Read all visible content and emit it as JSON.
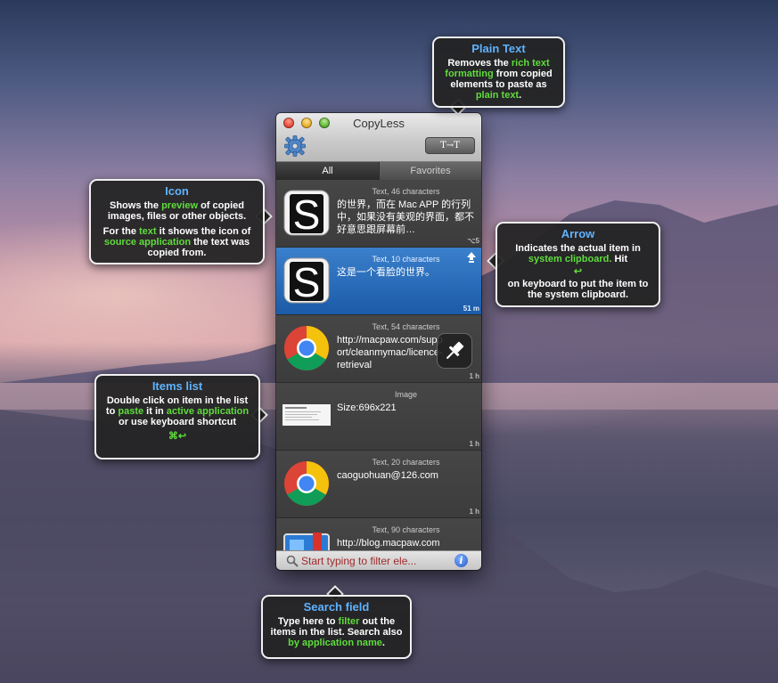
{
  "window": {
    "title": "CopyLess"
  },
  "toolbar": {
    "plain_text_button": "T→T"
  },
  "tabs": [
    {
      "label": "All",
      "active": true
    },
    {
      "label": "Favorites",
      "active": false
    }
  ],
  "items": [
    {
      "type": "Text, 46 characters",
      "text": "的世界，而在 Mac APP 的行列中，如果没有美观的界面，都不好意思跟屏幕前…",
      "time": "⌥5",
      "icon": "scrivener-icon"
    },
    {
      "type": "Text, 10 characters",
      "text": "这是一个看脸的世界。",
      "time": "51 m",
      "icon": "scrivener-icon",
      "selected": true
    },
    {
      "type": "Text, 54 characters",
      "text": "http://macpaw.com/support/cleanmymac/licence-retrieval",
      "time": "1 h",
      "icon": "chrome-icon"
    },
    {
      "type": "Image",
      "text": "Size:696x221",
      "time": "1 h",
      "icon": "image-preview"
    },
    {
      "type": "Text, 20 characters",
      "text": "caoguohuan@126.com",
      "time": "1 h",
      "icon": "chrome-icon"
    },
    {
      "type": "Text, 90 characters",
      "text": "http://blog.macpaw.com",
      "time": "",
      "icon": "finder-icon"
    }
  ],
  "search": {
    "placeholder": "Start typing to filter ele..."
  },
  "callouts": {
    "plain_text": {
      "title": "Plain Text",
      "p1": "Removes the ",
      "h1": "rich text formatting",
      "p2": " from copied elements to paste as ",
      "h2": "plain text",
      "p3": "."
    },
    "icon": {
      "title": "Icon",
      "a1": "Shows the ",
      "ah1": "preview",
      "a2": " of copied images, files or other objects.",
      "b1": "For the ",
      "bh1": "text",
      "b2": " it shows the icon of ",
      "bh2": "source application",
      "b3": " the text was copied from."
    },
    "arrow": {
      "title": "Arrow",
      "p1": "Indicates the actual item in ",
      "h1": "system clipboard.",
      "p2": " Hit",
      "key": "↩",
      "p3": "on keyboard to put the item to the system clipboard."
    },
    "items_list": {
      "title": "Items list",
      "p1": "Double click on item in the list to ",
      "h1": "paste",
      "p2": " it in ",
      "h2": "active application",
      "p3": " or use keyboard shortcut",
      "key": "⌘↩"
    },
    "search_field": {
      "title": "Search field",
      "p1": "Type here to ",
      "h1": "filter",
      "p2": " out the items in the list. Search also ",
      "h2": "by application name",
      "p3": "."
    }
  },
  "colors": {
    "highlight": "#5fdc3c",
    "callout_title": "#5fb3ff",
    "selection": "#1b5ba8"
  }
}
